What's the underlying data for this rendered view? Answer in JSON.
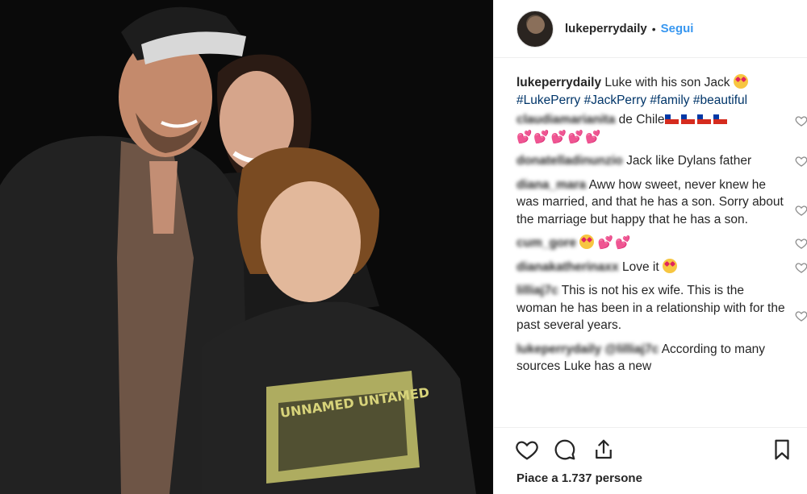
{
  "post": {
    "username": "lukeperrydaily",
    "dot": "•",
    "follow_label": "Segui",
    "caption_user": "lukeperrydaily",
    "caption_text": "Luke with his son Jack",
    "hashtags": [
      "#LukePerry",
      "#JackPerry",
      "#family",
      "#beautiful"
    ],
    "photo_shirt_text": "UNNAMED UNTAMED"
  },
  "comments": [
    {
      "user": "claudiamarianita",
      "text": "de Chile"
    },
    {
      "user": "donatelladinunzio",
      "text": "Jack like Dylans father"
    },
    {
      "user": "diana_mara",
      "text": "Aww how sweet, never knew he was married, and that he has a son. Sorry about the marriage but happy that he has a son."
    },
    {
      "user": "cum_gore",
      "text": ""
    },
    {
      "user": "dianakatherinaxx",
      "text": "Love it"
    },
    {
      "user": "lilliaj7c",
      "text": "This is not his ex wife. This is the woman he has been in a relationship with for the past several years."
    },
    {
      "user": "lukeperrydaily @lilliaj7c",
      "text": "According to many sources Luke has a new"
    }
  ],
  "likes_text": "Piace a 1.737 persone",
  "icons": [
    "heart-icon",
    "comment-icon",
    "share-icon",
    "bookmark-icon"
  ],
  "colors": {
    "link": "#3897f0",
    "hashtag": "#003569",
    "text": "#262626",
    "border": "#efefef"
  }
}
